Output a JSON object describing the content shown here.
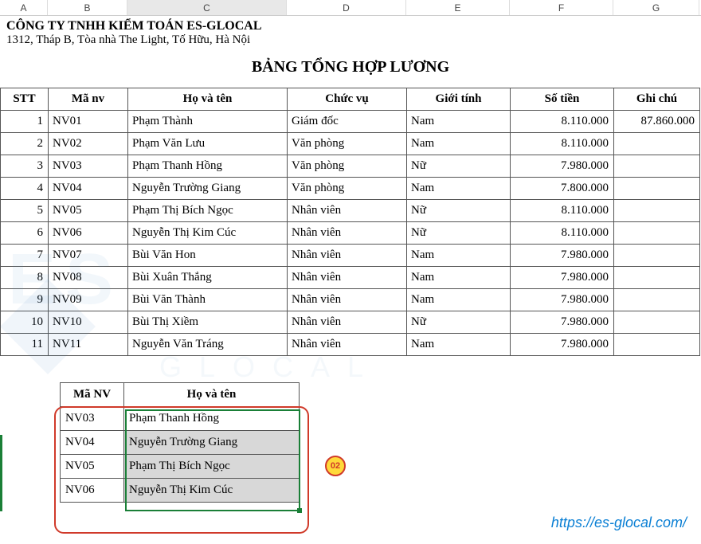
{
  "columns": {
    "A": "A",
    "B": "B",
    "C": "C",
    "D": "D",
    "E": "E",
    "F": "F",
    "G": "G"
  },
  "company": {
    "name": "CÔNG TY TNHH KIỂM TOÁN ES-GLOCAL",
    "address": "1312, Tháp B, Tòa nhà The Light, Tố Hữu, Hà Nội"
  },
  "title": "BẢNG TỔNG HỢP LƯƠNG",
  "headers": {
    "stt": "STT",
    "ma_nv": "Mã nv",
    "ho_ten": "Họ và tên",
    "chuc_vu": "Chức vụ",
    "gioi_tinh": "Giới tính",
    "so_tien": "Số tiền",
    "ghi_chu": "Ghi chú"
  },
  "rows": [
    {
      "stt": "1",
      "ma": "NV01",
      "ten": "Phạm Thành",
      "cv": "Giám đốc",
      "gt": "Nam",
      "tien": "8.110.000",
      "gc": "87.860.000"
    },
    {
      "stt": "2",
      "ma": "NV02",
      "ten": "Phạm Văn Lưu",
      "cv": "Văn phòng",
      "gt": "Nam",
      "tien": "8.110.000",
      "gc": ""
    },
    {
      "stt": "3",
      "ma": "NV03",
      "ten": "Phạm Thanh Hồng",
      "cv": "Văn phòng",
      "gt": "Nữ",
      "tien": "7.980.000",
      "gc": ""
    },
    {
      "stt": "4",
      "ma": "NV04",
      "ten": "Nguyễn Trường Giang",
      "cv": "Văn phòng",
      "gt": "Nam",
      "tien": "7.800.000",
      "gc": ""
    },
    {
      "stt": "5",
      "ma": "NV05",
      "ten": "Phạm Thị Bích Ngọc",
      "cv": "Nhân viên",
      "gt": "Nữ",
      "tien": "8.110.000",
      "gc": ""
    },
    {
      "stt": "6",
      "ma": "NV06",
      "ten": "Nguyễn Thị Kim Cúc",
      "cv": "Nhân viên",
      "gt": "Nữ",
      "tien": "8.110.000",
      "gc": ""
    },
    {
      "stt": "7",
      "ma": "NV07",
      "ten": "Bùi Văn Hon",
      "cv": "Nhân viên",
      "gt": "Nam",
      "tien": "7.980.000",
      "gc": ""
    },
    {
      "stt": "8",
      "ma": "NV08",
      "ten": "Bùi Xuân Thắng",
      "cv": "Nhân viên",
      "gt": "Nam",
      "tien": "7.980.000",
      "gc": ""
    },
    {
      "stt": "9",
      "ma": "NV09",
      "ten": "Bùi Văn Thành",
      "cv": "Nhân viên",
      "gt": "Nam",
      "tien": "7.980.000",
      "gc": ""
    },
    {
      "stt": "10",
      "ma": "NV10",
      "ten": "Bùi Thị Xiềm",
      "cv": "Nhân viên",
      "gt": "Nữ",
      "tien": "7.980.000",
      "gc": ""
    },
    {
      "stt": "11",
      "ma": "NV11",
      "ten": "Nguyễn Văn Tráng",
      "cv": "Nhân viên",
      "gt": "Nam",
      "tien": "7.980.000",
      "gc": ""
    }
  ],
  "small_headers": {
    "ma": "Mã NV",
    "ten": "Họ và tên"
  },
  "small_rows": [
    {
      "ma": "NV03",
      "ten": "Phạm Thanh Hồng",
      "sel": false
    },
    {
      "ma": "NV04",
      "ten": "Nguyễn Trường Giang",
      "sel": true
    },
    {
      "ma": "NV05",
      "ten": "Phạm Thị Bích Ngọc",
      "sel": true
    },
    {
      "ma": "NV06",
      "ten": "Nguyễn Thị Kim Cúc",
      "sel": true
    }
  ],
  "badge": "02",
  "link": "https://es-glocal.com/"
}
